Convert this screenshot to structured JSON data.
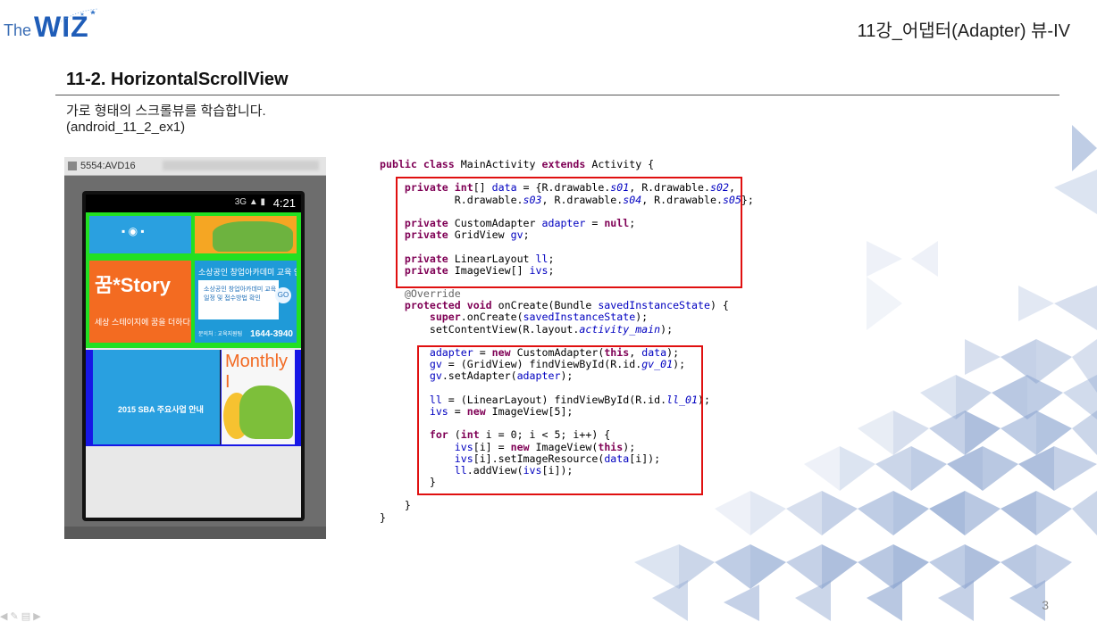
{
  "logo": {
    "the": "The",
    "wiz": "WIZ"
  },
  "chapter_title": "11강_어댑터(Adapter) 뷰-IV",
  "section_title": "11-2. HorizontalScrollView",
  "description": {
    "line1": "가로 형태의 스크롤뷰를 학습합니다.",
    "line2": "(android_11_2_ex1)"
  },
  "emulator": {
    "window_title": "5554:AVD16",
    "status_time": "4:21",
    "status_icons": "3G ▲ ▮",
    "tiles": {
      "story_title": "꿈*Story",
      "story_sub": "세상 스테이지에 꿈을 더하다",
      "t4_heading": "소상공인 창업아카데미 교육 안내",
      "t4_box": "소상공인 창업아카데미 교육 일정 및 접수방법 확인",
      "t4_go": "GO",
      "t4_phone_label": "문의처 : 교육지원팀",
      "t4_phone": "1644-3940",
      "t5_caption": "2015 SBA 주요사업 안내",
      "t6_title": "Monthly I"
    }
  },
  "code_lines": [
    [
      [
        "kw",
        "public class "
      ],
      [
        "",
        "MainActivity "
      ],
      [
        "kw",
        "extends "
      ],
      [
        "",
        "Activity {"
      ]
    ],
    [
      [
        "",
        ""
      ]
    ],
    [
      [
        "",
        "    "
      ],
      [
        "kw",
        "private int"
      ],
      [
        "",
        "[] "
      ],
      [
        "fld",
        "data"
      ],
      [
        "",
        "",
        " = {R.drawable."
      ],
      [
        "st",
        "s01"
      ],
      [
        "",
        ", R.drawable."
      ],
      [
        "st",
        "s02"
      ],
      [
        "",
        ","
      ]
    ],
    [
      [
        "",
        "            R.drawable."
      ],
      [
        "st",
        "s03"
      ],
      [
        "",
        ", R.drawable."
      ],
      [
        "st",
        "s04"
      ],
      [
        "",
        ", R.drawable."
      ],
      [
        "st",
        "s05"
      ],
      [
        "",
        "};"
      ]
    ],
    [
      [
        "",
        ""
      ]
    ],
    [
      [
        "",
        "    "
      ],
      [
        "kw",
        "private "
      ],
      [
        "",
        "CustomAdapter "
      ],
      [
        "fld",
        "adapter"
      ],
      [
        "",
        " = "
      ],
      [
        "kw",
        "null"
      ],
      [
        "",
        ";"
      ]
    ],
    [
      [
        "",
        "    "
      ],
      [
        "kw",
        "private "
      ],
      [
        "",
        "GridView "
      ],
      [
        "fld",
        "gv"
      ],
      [
        "",
        ";"
      ]
    ],
    [
      [
        "",
        ""
      ]
    ],
    [
      [
        "",
        "    "
      ],
      [
        "kw",
        "private "
      ],
      [
        "",
        "LinearLayout "
      ],
      [
        "fld",
        "ll"
      ],
      [
        "",
        ";"
      ]
    ],
    [
      [
        "",
        "    "
      ],
      [
        "kw",
        "private "
      ],
      [
        "",
        "ImageView[] "
      ],
      [
        "fld",
        "ivs"
      ],
      [
        "",
        ";"
      ]
    ],
    [
      [
        "",
        ""
      ]
    ],
    [
      [
        "ann",
        "    @Override"
      ]
    ],
    [
      [
        "",
        "    "
      ],
      [
        "kw",
        "protected void "
      ],
      [
        "",
        "onCreate(Bundle "
      ],
      [
        "fld",
        "savedInstanceState"
      ],
      [
        "",
        ") {"
      ]
    ],
    [
      [
        "",
        "        "
      ],
      [
        "kw",
        "super"
      ],
      [
        "",
        ".onCreate("
      ],
      [
        "fld",
        "savedInstanceState"
      ],
      [
        "",
        ");"
      ]
    ],
    [
      [
        "",
        "        setContentView(R.layout."
      ],
      [
        "st",
        "activity_main"
      ],
      [
        "",
        ");"
      ]
    ],
    [
      [
        "",
        ""
      ]
    ],
    [
      [
        "",
        "        "
      ],
      [
        "fld",
        "adapter"
      ],
      [
        "",
        " = "
      ],
      [
        "kw",
        "new "
      ],
      [
        "",
        "CustomAdapter("
      ],
      [
        "kw",
        "this"
      ],
      [
        "",
        ", "
      ],
      [
        "fld",
        "data"
      ],
      [
        "",
        ");"
      ]
    ],
    [
      [
        "",
        "        "
      ],
      [
        "fld",
        "gv"
      ],
      [
        "",
        " = (GridView) findViewById(R.id."
      ],
      [
        "st",
        "gv_01"
      ],
      [
        "",
        ");"
      ]
    ],
    [
      [
        "",
        "        "
      ],
      [
        "fld",
        "gv"
      ],
      [
        "",
        ".setAdapter("
      ],
      [
        "fld",
        "adapter"
      ],
      [
        "",
        ");"
      ]
    ],
    [
      [
        "",
        ""
      ]
    ],
    [
      [
        "",
        "        "
      ],
      [
        "fld",
        "ll"
      ],
      [
        "",
        " = (LinearLayout) findViewById(R.id."
      ],
      [
        "st",
        "ll_01"
      ],
      [
        "",
        ");"
      ]
    ],
    [
      [
        "",
        "        "
      ],
      [
        "fld",
        "ivs"
      ],
      [
        "",
        " = "
      ],
      [
        "kw",
        "new "
      ],
      [
        "",
        "ImageView[5];"
      ]
    ],
    [
      [
        "",
        ""
      ]
    ],
    [
      [
        "",
        "        "
      ],
      [
        "kw",
        "for "
      ],
      [
        "",
        "("
      ],
      [
        "kw",
        "int "
      ],
      [
        "",
        "i = 0; i < 5; i++) {"
      ]
    ],
    [
      [
        "",
        "            "
      ],
      [
        "fld",
        "ivs"
      ],
      [
        "",
        "[i] = "
      ],
      [
        "kw",
        "new "
      ],
      [
        "",
        "ImageView("
      ],
      [
        "kw",
        "this"
      ],
      [
        "",
        ");"
      ]
    ],
    [
      [
        "",
        "            "
      ],
      [
        "fld",
        "ivs"
      ],
      [
        "",
        "[i].setImageResource("
      ],
      [
        "fld",
        "data"
      ],
      [
        "",
        "[i]);"
      ]
    ],
    [
      [
        "",
        "            "
      ],
      [
        "fld",
        "ll"
      ],
      [
        "",
        ".addView("
      ],
      [
        "fld",
        "ivs"
      ],
      [
        "",
        "[i]);"
      ]
    ],
    [
      [
        "",
        "        }"
      ]
    ],
    [
      [
        "",
        ""
      ]
    ],
    [
      [
        "",
        "    }"
      ]
    ],
    [
      [
        "",
        "}"
      ]
    ]
  ],
  "page_number": "3",
  "colors": {
    "highlight": "#e01010",
    "keyword": "#7f0055",
    "field": "#0000c0",
    "deco": "#8ba4cf"
  }
}
